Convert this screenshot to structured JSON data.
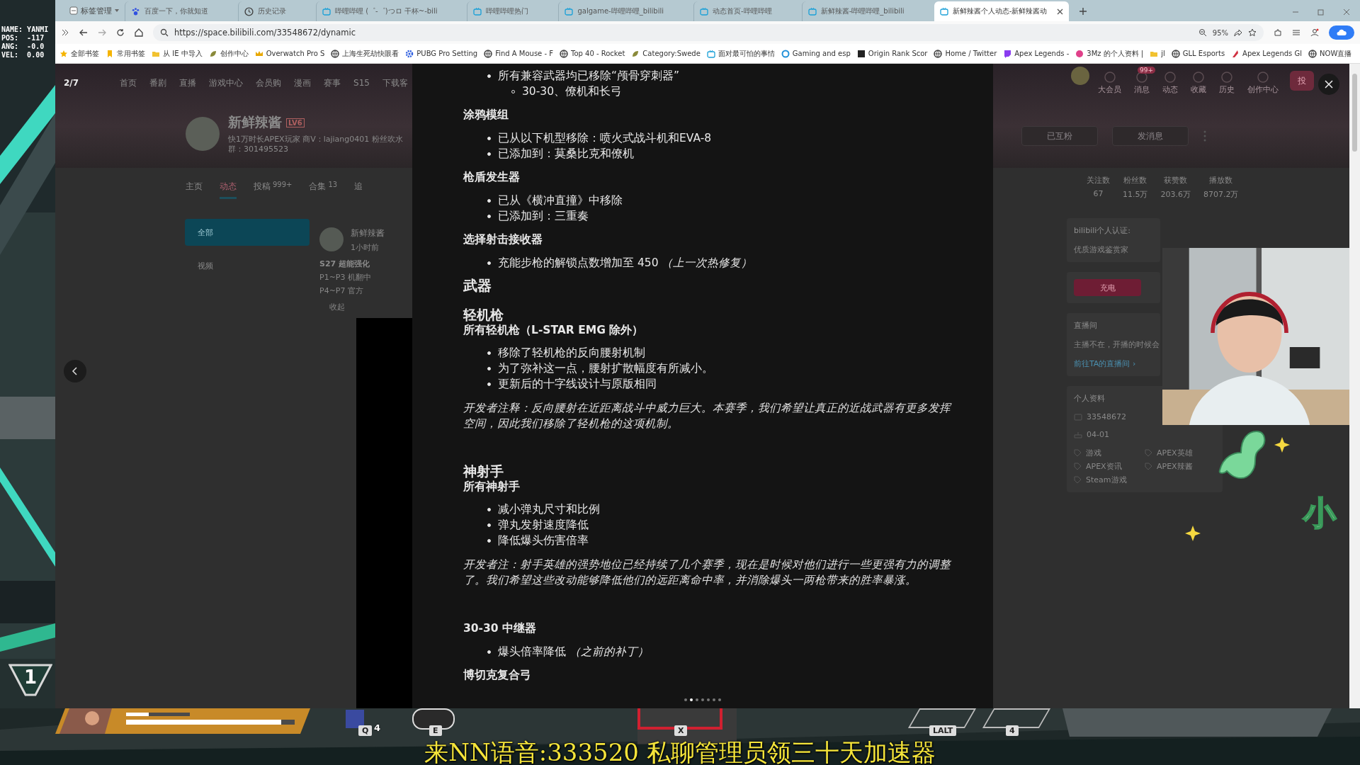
{
  "game_overlay": {
    "debug_lines": [
      "NAME: YANMI",
      "POS:  -117",
      "ANG:  -0.0",
      "VEL:  0.00"
    ],
    "rank": "1"
  },
  "browser": {
    "tab_group": "标签管理",
    "tabs": [
      {
        "title": "百度一下，你就知道",
        "kind": "paw",
        "selected": false
      },
      {
        "title": "历史记录",
        "kind": "clock",
        "selected": false
      },
      {
        "title": "哔哩哔哩 (゜-゜)つロ 干杯~-bili",
        "kind": "tv",
        "selected": false
      },
      {
        "title": "哔哩哔哩热门",
        "kind": "tv",
        "selected": false
      },
      {
        "title": "galgame-哔哩哔哩_bilibili",
        "kind": "tv",
        "selected": false
      },
      {
        "title": "动态首页-哔哩哔哩",
        "kind": "tv",
        "selected": false
      },
      {
        "title": "新鲜辣酱-哔哩哔哩_bilibili",
        "kind": "tv",
        "selected": false
      },
      {
        "title": "新鲜辣酱个人动态-新鲜辣酱动",
        "kind": "tv",
        "selected": true
      }
    ],
    "address": "https://space.bilibili.com/33548672/dynamic",
    "zoom": "95%",
    "bookmarks": [
      {
        "label": "全部书签",
        "kind": "star"
      },
      {
        "label": "常用书签",
        "kind": "ribbon"
      },
      {
        "label": "从 IE 中导入",
        "kind": "folder"
      },
      {
        "label": "创作中心",
        "kind": "leaf"
      },
      {
        "label": "Overwatch Pro S",
        "kind": "crown"
      },
      {
        "label": "上海生死劫快眼看",
        "kind": "globe"
      },
      {
        "label": "PUBG Pro Setting",
        "kind": "gear"
      },
      {
        "label": "Find A Mouse - F",
        "kind": "globe"
      },
      {
        "label": "Top 40 - Rocket",
        "kind": "globe"
      },
      {
        "label": "Category:Swede",
        "kind": "leaf"
      },
      {
        "label": "面对最可怕的事情",
        "kind": "tv"
      },
      {
        "label": "Gaming and esp",
        "kind": "ring"
      },
      {
        "label": "Origin Rank Scor",
        "kind": "square"
      },
      {
        "label": "Home / Twitter",
        "kind": "globe"
      },
      {
        "label": "Apex Legends -",
        "kind": "twitch"
      },
      {
        "label": "3Mz 的个人资料 |",
        "kind": "dot"
      },
      {
        "label": "jl",
        "kind": "folder"
      },
      {
        "label": "GLL Esports",
        "kind": "globe"
      },
      {
        "label": "Apex Legends Gl",
        "kind": "apex"
      },
      {
        "label": "NOW直播",
        "kind": "globe"
      }
    ]
  },
  "page": {
    "counter": "2/7",
    "nav": [
      "首页",
      "番剧",
      "直播",
      "游戏中心",
      "会员购",
      "漫画",
      "赛事",
      "S15",
      "下载客"
    ],
    "profile": {
      "name": "新鲜辣酱",
      "level": "LV6",
      "sign": "快1万时长APEX玩家 商V：lajiang0401 粉丝吹水群：301495523"
    },
    "tabs": [
      {
        "label": "主页",
        "selected": false
      },
      {
        "label": "动态",
        "selected": true
      },
      {
        "label": "投稿",
        "count": "999+",
        "selected": false
      },
      {
        "label": "合集",
        "count": "13",
        "selected": false
      },
      {
        "label": "追",
        "selected": false
      }
    ],
    "filters": [
      {
        "label": "全部",
        "selected": true
      },
      {
        "label": "视频",
        "selected": false
      }
    ],
    "post": {
      "author": "新鲜辣酱",
      "time": "1小时前",
      "title": "S27 超能强化",
      "lines": [
        "P1~P3 机翻中",
        "P4~P7 官方"
      ],
      "collapse": "收起"
    },
    "top_icons": [
      {
        "label": "大会员"
      },
      {
        "label": "消息",
        "badge": "99+"
      },
      {
        "label": "动态"
      },
      {
        "label": "收藏"
      },
      {
        "label": "历史"
      },
      {
        "label": "创作中心"
      }
    ],
    "upload": "投",
    "banner_buttons": [
      "已互粉",
      "发消息"
    ],
    "stats": [
      {
        "label": "关注数",
        "value": "67"
      },
      {
        "label": "粉丝数",
        "value": "11.5万"
      },
      {
        "label": "获赞数",
        "value": "203.6万"
      },
      {
        "label": "播放数",
        "value": "8707.2万"
      }
    ],
    "verify": {
      "title": "bilibili个人认证:",
      "text": "优质游戏鉴赏家"
    },
    "charge": "充电",
    "live": {
      "title": "直播间",
      "text": "主播不在，开播的时候会",
      "link": "前往TA的直播间 ›"
    },
    "info": {
      "title": "个人资料",
      "uid": "33548672",
      "birthday": "04-01",
      "tags": [
        "游戏",
        "APEX英雄",
        "APEX资讯",
        "APEX辣酱",
        "Steam游戏"
      ]
    }
  },
  "modal": {
    "blocks": [
      {
        "kind": "list",
        "items": [
          {
            "text": "所有兼容武器均已移除“颅骨穿刺器”",
            "children": [
              "30-30、僚机和长弓"
            ]
          }
        ]
      },
      {
        "kind": "heading",
        "text": "涂鸦模组"
      },
      {
        "kind": "list",
        "items": [
          {
            "text": "已从以下机型移除：喷火式战斗机和EVA-8"
          },
          {
            "text": "已添加到：莫桑比克和僚机"
          }
        ]
      },
      {
        "kind": "heading",
        "text": "枪盾发生器"
      },
      {
        "kind": "list",
        "items": [
          {
            "text": "已从《横冲直撞》中移除"
          },
          {
            "text": "已添加到：三重奏"
          }
        ]
      },
      {
        "kind": "heading",
        "text": "选择射击接收器"
      },
      {
        "kind": "list",
        "items": [
          {
            "text": "充能步枪的解锁点数增加至 450 *（上一次热修复）*"
          }
        ]
      },
      {
        "kind": "section",
        "text": "武器"
      },
      {
        "kind": "title",
        "text": "轻机枪"
      },
      {
        "kind": "subtitle",
        "text": "所有轻机枪（L-STAR EMG 除外）"
      },
      {
        "kind": "list",
        "items": [
          {
            "text": "移除了轻机枪的反向腰射机制"
          },
          {
            "text": "为了弥补这一点，腰射扩散幅度有所减小。"
          },
          {
            "text": "更新后的十字线设计与原版相同"
          }
        ]
      },
      {
        "kind": "note",
        "text": "开发者注释：反向腰射在近距离战斗中威力巨大。本赛季，我们希望让真正的近战武器有更多发挥空间，因此我们移除了轻机枪的这项机制。"
      },
      {
        "kind": "title",
        "text": "神射手"
      },
      {
        "kind": "subtitle",
        "text": "所有神射手"
      },
      {
        "kind": "list",
        "items": [
          {
            "text": "减小弹丸尺寸和比例"
          },
          {
            "text": "弹丸发射速度降低"
          },
          {
            "text": "降低爆头伤害倍率"
          }
        ]
      },
      {
        "kind": "note",
        "text": "开发者注：射手英雄的强势地位已经持续了几个赛季，现在是时候对他们进行一些更强有力的调整了。我们希望这些改动能够降低他们的远距离命中率，并消除爆头一两枪带来的胜率暴涨。"
      },
      {
        "kind": "heading",
        "text": "30-30 中继器"
      },
      {
        "kind": "list",
        "items": [
          {
            "text": "爆头倍率降低 *（之前的补丁）*"
          }
        ]
      },
      {
        "kind": "heading",
        "text": "博切克复合弓"
      }
    ],
    "pager": [
      {
        "selected": false
      },
      {
        "selected": true
      },
      {
        "selected": false
      },
      {
        "selected": false
      },
      {
        "selected": false
      },
      {
        "selected": false
      },
      {
        "selected": false
      }
    ]
  },
  "hud": {
    "shield": {
      "level": 0.35
    },
    "health": {
      "level": 0.92
    },
    "tactical_count": "4",
    "keys": [
      "Q",
      "E",
      "X",
      "LALT",
      "4"
    ],
    "subtitle": "来NN语音:333520 私聊管理员领三十天加速器",
    "sticker": "小"
  }
}
